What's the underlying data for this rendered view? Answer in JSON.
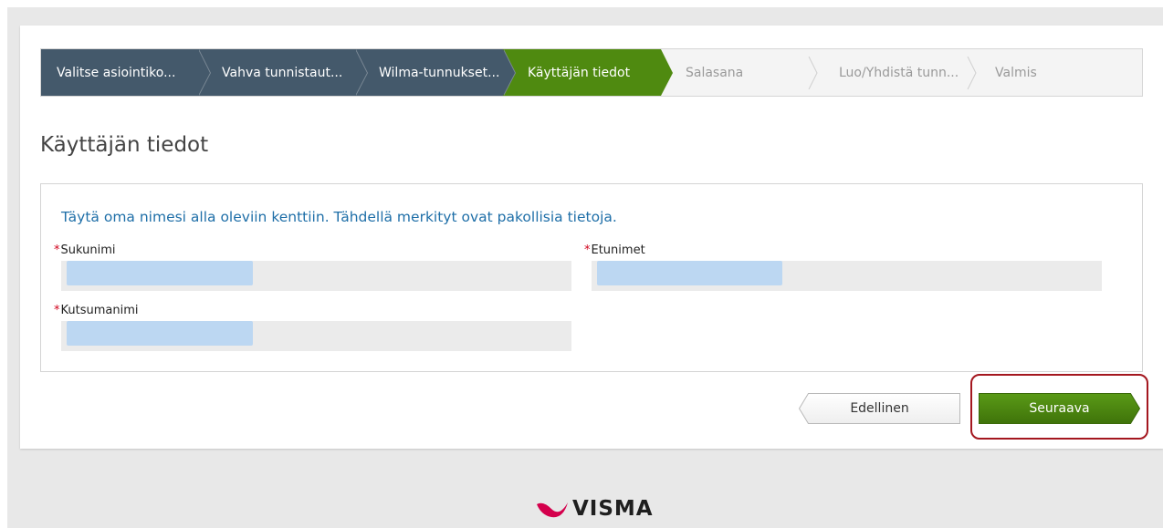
{
  "wizard": {
    "steps": [
      {
        "label": "Valitse asiointiko...",
        "state": "done"
      },
      {
        "label": "Vahva tunnistaut...",
        "state": "done"
      },
      {
        "label": "Wilma-tunnukset...",
        "state": "done"
      },
      {
        "label": "Käyttäjän tiedot",
        "state": "active"
      },
      {
        "label": "Salasana",
        "state": "pending"
      },
      {
        "label": "Luo/Yhdistä tunn...",
        "state": "pending"
      },
      {
        "label": "Valmis",
        "state": "pending"
      }
    ]
  },
  "page": {
    "title": "Käyttäjän tiedot"
  },
  "form": {
    "instructions": "Täytä oma nimesi alla oleviin kenttiin. Tähdellä merkityt ovat pakollisia tietoja.",
    "required_marker": "*",
    "fields": {
      "surname": {
        "label": "Sukunimi"
      },
      "first_names": {
        "label": "Etunimet"
      },
      "nickname": {
        "label": "Kutsumanimi"
      }
    }
  },
  "buttons": {
    "previous": "Edellinen",
    "next": "Seuraava"
  },
  "logo": {
    "text": "VISMA"
  },
  "colors": {
    "step_done": "#44596b",
    "step_active": "#4f8a10",
    "button_next": "#4f8a10",
    "instructions_text": "#1f6fa8",
    "required": "#d0021b",
    "highlight": "#a4171f",
    "logo_mark": "#d4004c"
  }
}
